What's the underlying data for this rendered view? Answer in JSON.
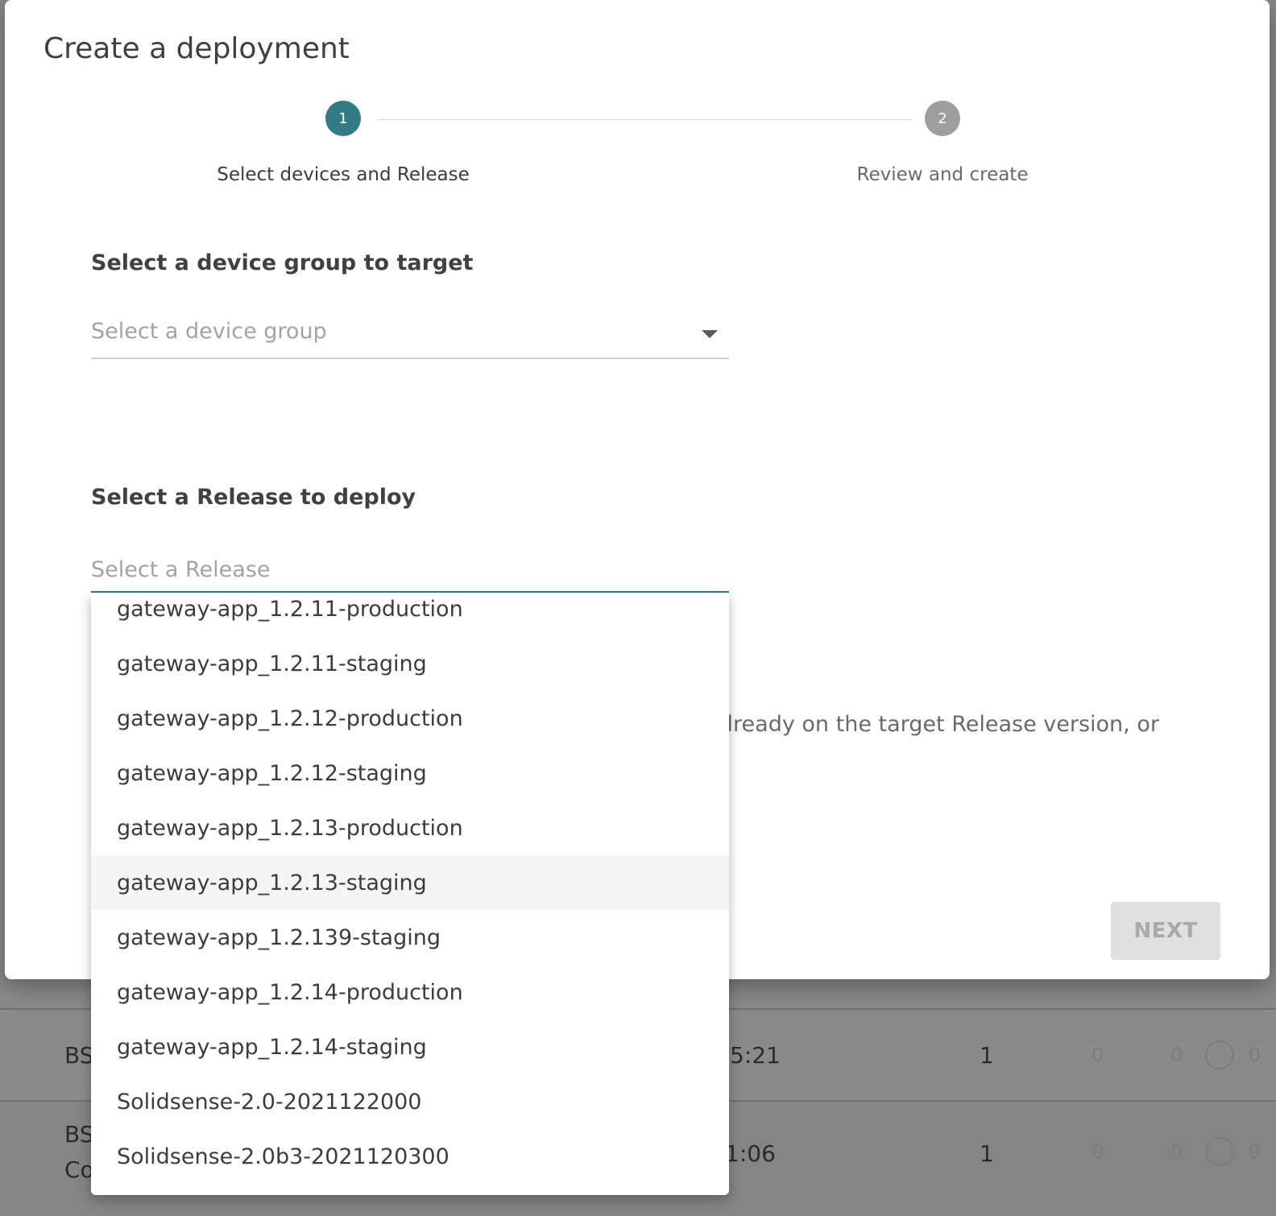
{
  "modal": {
    "title": "Create a deployment",
    "steps": [
      {
        "number": "1",
        "label": "Select devices and Release",
        "state": "active"
      },
      {
        "number": "2",
        "label": "Review and create",
        "state": "inactive"
      }
    ],
    "device_group": {
      "heading": "Select a device group to target",
      "placeholder": "Select a device group"
    },
    "release": {
      "heading": "Select a Release to deploy",
      "placeholder": "Select a Release",
      "options": [
        "gateway-app_1.2.11-production",
        "gateway-app_1.2.11-staging",
        "gateway-app_1.2.12-production",
        "gateway-app_1.2.12-staging",
        "gateway-app_1.2.13-production",
        "gateway-app_1.2.13-staging",
        "gateway-app_1.2.139-staging",
        "gateway-app_1.2.14-production",
        "gateway-app_1.2.14-staging",
        "Solidsense-2.0-2021122000",
        "Solidsense-2.0b3-2021120300"
      ],
      "highlighted_option": "gateway-app_1.2.13-staging"
    },
    "hint_partial": "already on the target Release version, or",
    "next_label": "NEXT"
  },
  "background_table": {
    "rows": [
      {
        "name": "BS",
        "time": "5:21",
        "count": "1",
        "zeros": [
          "0",
          "0",
          "0"
        ]
      },
      {
        "name": "BS",
        "name2": "Co",
        "time": "1:06",
        "count": "1",
        "zeros": [
          "0",
          "0",
          "0"
        ]
      }
    ]
  },
  "colors": {
    "accent": "#337a87",
    "inactive_step": "#9e9e9e",
    "disabled_button_bg": "#e0e0e0"
  }
}
